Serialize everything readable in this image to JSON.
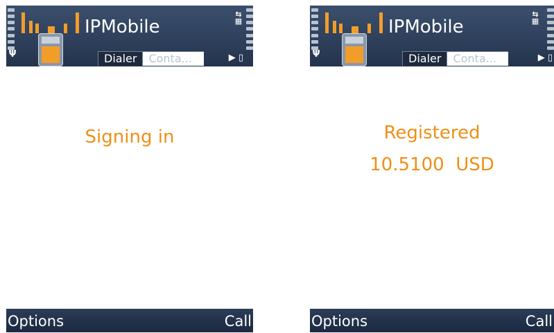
{
  "screens": [
    {
      "app_title": "IPMobile",
      "tabs": {
        "active": "Dialer",
        "inactive": "Conta..."
      },
      "status": [
        "Signing in"
      ],
      "softkeys": {
        "left": "Options",
        "right": "Call"
      }
    },
    {
      "app_title": "IPMobile",
      "tabs": {
        "active": "Dialer",
        "inactive": "Conta..."
      },
      "status": [
        "Registered",
        "10.5100  USD"
      ],
      "softkeys": {
        "left": "Options",
        "right": "Call"
      }
    }
  ],
  "colors": {
    "header_bg": "#2f4260",
    "accent_orange": "#ee8f17",
    "softkey_bg": "#22324c"
  },
  "icons": {
    "signal": "signal-strength-icon",
    "antenna": "antenna-icon",
    "battery": "battery-level-icon",
    "network": "network-mode-icon",
    "app": "app-icon",
    "scroll": "tab-scroll-arrow-icon"
  }
}
